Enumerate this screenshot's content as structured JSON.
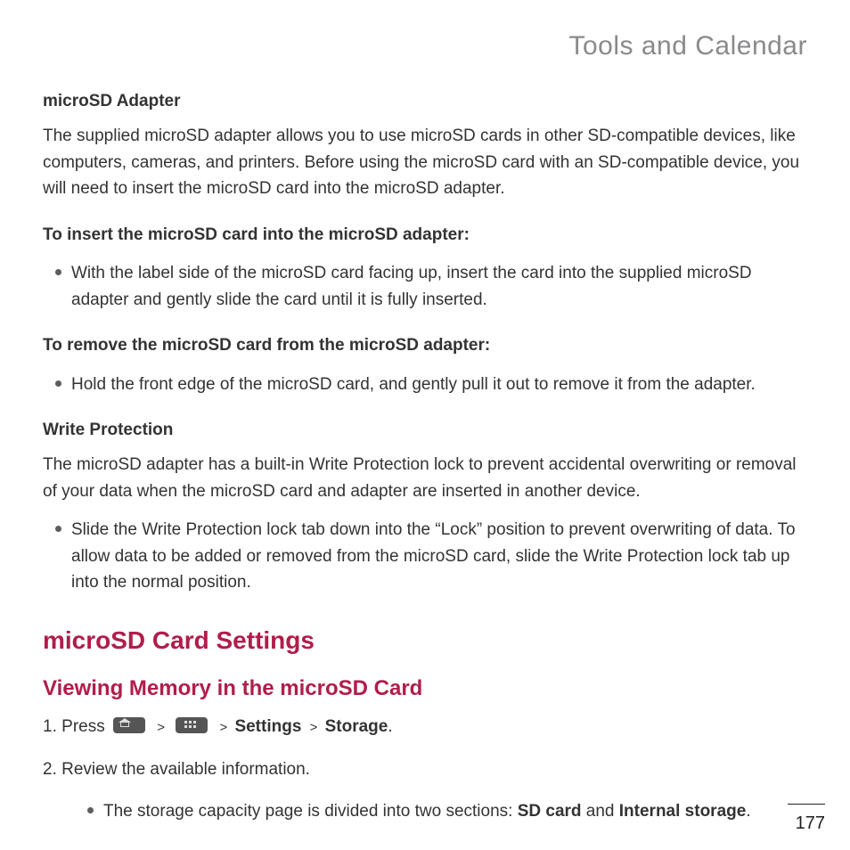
{
  "header": {
    "title": "Tools and Calendar"
  },
  "section1": {
    "heading": "microSD Adapter",
    "para": "The supplied microSD adapter allows you to use microSD cards in other SD-compatible devices, like computers, cameras, and printers. Before using the microSD card with an SD-compatible device, you will need to insert the microSD card into the microSD adapter.",
    "insert_heading": "To insert the microSD card into the microSD adapter:",
    "insert_bullet": "With the label side of the microSD card facing up, insert the card into the supplied microSD adapter and gently slide the card until it is fully inserted.",
    "remove_heading": "To remove the microSD card from the microSD adapter:",
    "remove_bullet": "Hold the front edge of the microSD card, and gently pull it out to remove it from the adapter."
  },
  "section2": {
    "heading": "Write Protection",
    "para": "The microSD adapter has a built-in Write Protection lock to prevent accidental overwriting or removal of your data when the microSD card and adapter are inserted in another device.",
    "bullet": "Slide the Write Protection lock tab down into the “Lock” position to prevent overwriting of data. To allow data to be added or removed from the microSD card, slide the Write Protection lock tab up into the normal position."
  },
  "section3": {
    "h2": "microSD Card Settings",
    "h3": "Viewing Memory in the microSD Card",
    "step1_a": "Press ",
    "step1_sep": " > ",
    "step1_settings": "Settings",
    "step1_storage": "Storage",
    "step1_end": ".",
    "step2": "Review the available information.",
    "sub_a": "The storage capacity page is divided into two sections: ",
    "sub_b": "SD card",
    "sub_c": " and ",
    "sub_d": "Internal storage",
    "sub_e": "."
  },
  "footer": {
    "page": "177"
  }
}
